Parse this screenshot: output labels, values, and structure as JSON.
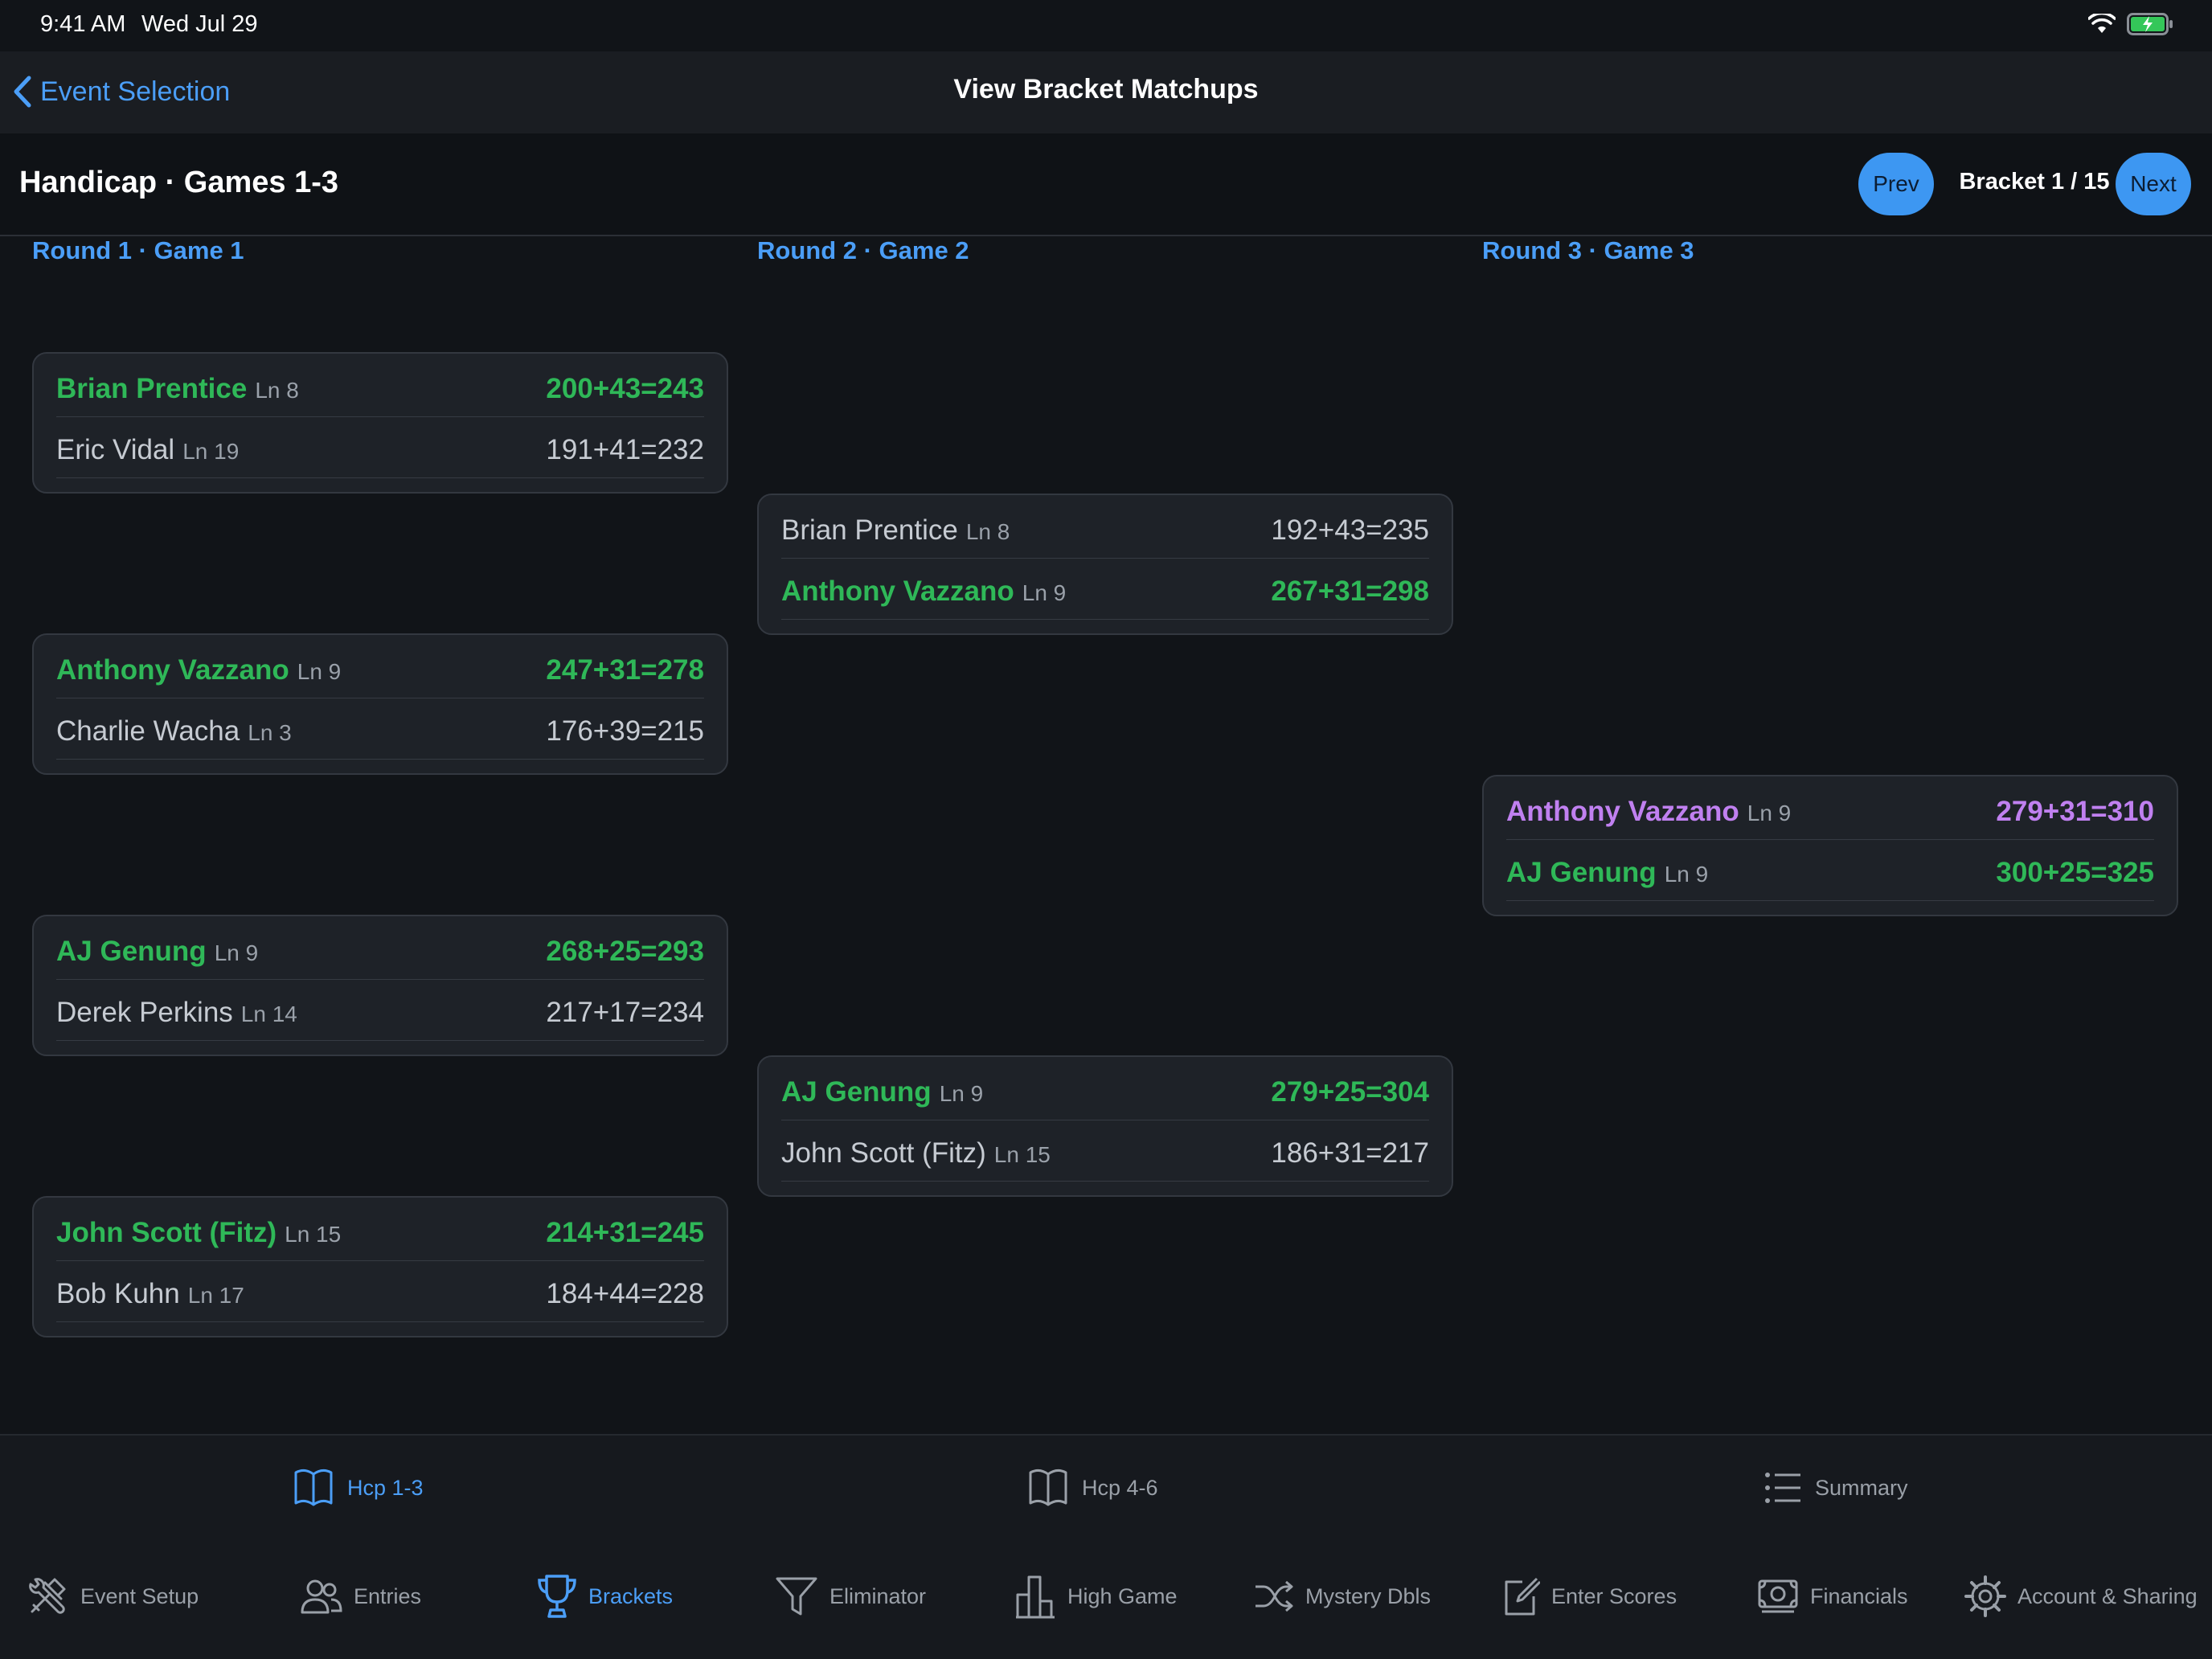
{
  "status": {
    "time": "9:41 AM",
    "date": "Wed Jul 29"
  },
  "nav": {
    "back_label": "Event Selection",
    "title": "View Bracket Matchups"
  },
  "header": {
    "event_title": "Handicap · Games 1-3",
    "prev_label": "Prev",
    "next_label": "Next",
    "bracket_counter": "Bracket 1 / 15"
  },
  "rounds": [
    {
      "label": "Round 1 · Game 1"
    },
    {
      "label": "Round 2 · Game 2"
    },
    {
      "label": "Round 3 · Game 3"
    }
  ],
  "matches": [
    {
      "players": [
        {
          "name": "Brian Prentice",
          "lane": "Ln 8",
          "score": "200+43=243",
          "result": "win"
        },
        {
          "name": "Eric Vidal",
          "lane": "Ln 19",
          "score": "191+41=232",
          "result": "lose"
        }
      ]
    },
    {
      "players": [
        {
          "name": "Anthony Vazzano",
          "lane": "Ln 9",
          "score": "247+31=278",
          "result": "win"
        },
        {
          "name": "Charlie Wacha",
          "lane": "Ln 3",
          "score": "176+39=215",
          "result": "lose"
        }
      ]
    },
    {
      "players": [
        {
          "name": "AJ Genung",
          "lane": "Ln 9",
          "score": "268+25=293",
          "result": "win"
        },
        {
          "name": "Derek Perkins",
          "lane": "Ln 14",
          "score": "217+17=234",
          "result": "lose"
        }
      ]
    },
    {
      "players": [
        {
          "name": "John Scott (Fitz)",
          "lane": "Ln 15",
          "score": "214+31=245",
          "result": "win"
        },
        {
          "name": "Bob Kuhn",
          "lane": "Ln 17",
          "score": "184+44=228",
          "result": "lose"
        }
      ]
    },
    {
      "players": [
        {
          "name": "Brian Prentice",
          "lane": "Ln 8",
          "score": "192+43=235",
          "result": "lose"
        },
        {
          "name": "Anthony Vazzano",
          "lane": "Ln 9",
          "score": "267+31=298",
          "result": "win"
        }
      ]
    },
    {
      "players": [
        {
          "name": "AJ Genung",
          "lane": "Ln 9",
          "score": "279+25=304",
          "result": "win"
        },
        {
          "name": "John Scott (Fitz)",
          "lane": "Ln 15",
          "score": "186+31=217",
          "result": "lose"
        }
      ]
    },
    {
      "players": [
        {
          "name": "Anthony Vazzano",
          "lane": "Ln 9",
          "score": "279+31=310",
          "result": "champ"
        },
        {
          "name": "AJ Genung",
          "lane": "Ln 9",
          "score": "300+25=325",
          "result": "win"
        }
      ]
    }
  ],
  "subtabs": [
    {
      "label": "Hcp 1-3",
      "icon": "open-book-icon",
      "active": true
    },
    {
      "label": "Hcp 4-6",
      "icon": "open-book-icon",
      "active": false
    },
    {
      "label": "Summary",
      "icon": "list-icon",
      "active": false
    }
  ],
  "tabs": [
    {
      "label": "Event Setup",
      "icon": "tools-icon"
    },
    {
      "label": "Entries",
      "icon": "people-icon"
    },
    {
      "label": "Brackets",
      "icon": "trophy-icon"
    },
    {
      "label": "Eliminator",
      "icon": "funnel-icon"
    },
    {
      "label": "High Game",
      "icon": "bar-chart-icon"
    },
    {
      "label": "Mystery Dbls",
      "icon": "shuffle-icon"
    },
    {
      "label": "Enter Scores",
      "icon": "edit-icon"
    },
    {
      "label": "Financials",
      "icon": "money-icon"
    },
    {
      "label": "Account & Sharing",
      "icon": "gear-icon"
    }
  ],
  "active_tab": "Brackets",
  "colors": {
    "accent": "#4b9ef7",
    "winner": "#2fb858",
    "champion": "#c080f0",
    "loser": "#c6cbd2",
    "background": "#111418"
  }
}
